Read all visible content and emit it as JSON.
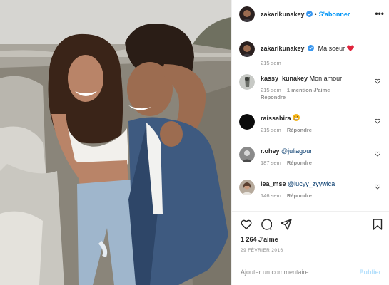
{
  "post": {
    "author": "zakarikunakey",
    "follow_label": "S'abonner",
    "dot": "•",
    "more": "•••",
    "verified": true
  },
  "comments": [
    {
      "user": "zakarikunakey",
      "text": "Ma soeur ",
      "emoji": "heart",
      "verified": true,
      "time": "215 sem",
      "likes": "",
      "reply": ""
    },
    {
      "user": "kassy_kunakey",
      "text": "Mon amour",
      "verified": false,
      "time": "215 sem",
      "likes": "1 mention J'aime",
      "reply": "Répondre"
    },
    {
      "user": "raissahira",
      "text": "",
      "emoji": "grimace",
      "verified": false,
      "time": "215 sem",
      "likes": "",
      "reply": "Répondre"
    },
    {
      "user": "r.ohey",
      "text": "@juliagour",
      "verified": false,
      "time": "187 sem",
      "likes": "",
      "reply": "Répondre"
    },
    {
      "user": "lea_mse",
      "text": "@lucyy_zyywica",
      "verified": false,
      "time": "146 sem",
      "likes": "",
      "reply": "Répondre"
    }
  ],
  "stats": {
    "likes": "1 264 J'aime",
    "date": "29 FÉVRIER 2016"
  },
  "composer": {
    "placeholder": "Ajouter un commentaire...",
    "publish_label": "Publier"
  },
  "colors": {
    "accent": "#0095f6",
    "heart": "#ed4956",
    "publish_disabled": "#b2dffc",
    "meta": "#8e8e8e"
  },
  "icons": [
    "heart-icon",
    "comment-icon",
    "share-icon",
    "bookmark-icon",
    "verified-icon",
    "more-options-icon"
  ]
}
